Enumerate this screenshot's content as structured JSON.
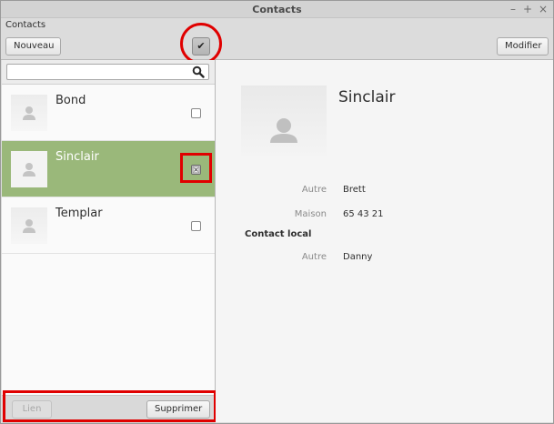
{
  "window": {
    "title": "Contacts",
    "controls": [
      "–",
      "+",
      "×"
    ]
  },
  "menubar": {
    "label": "Contacts"
  },
  "toolbar": {
    "new_label": "Nouveau",
    "select_toggle_glyph": "✔",
    "edit_label": "Modifier"
  },
  "search": {
    "value": "",
    "placeholder": ""
  },
  "contacts": [
    {
      "name": "Bond",
      "selected": false,
      "checked": false
    },
    {
      "name": "Sinclair",
      "selected": true,
      "checked": true
    },
    {
      "name": "Templar",
      "selected": false,
      "checked": false
    }
  ],
  "actions": {
    "link_label": "Lien",
    "delete_label": "Supprimer"
  },
  "details": {
    "name": "Sinclair",
    "fields": [
      {
        "label": "Autre",
        "value": "Brett"
      },
      {
        "label": "Maison",
        "value": "65 43 21"
      }
    ],
    "section_title": "Contact local",
    "local_fields": [
      {
        "label": "Autre",
        "value": "Danny"
      }
    ]
  },
  "colors": {
    "selection": "#9ab87a",
    "highlight": "#e00000"
  }
}
